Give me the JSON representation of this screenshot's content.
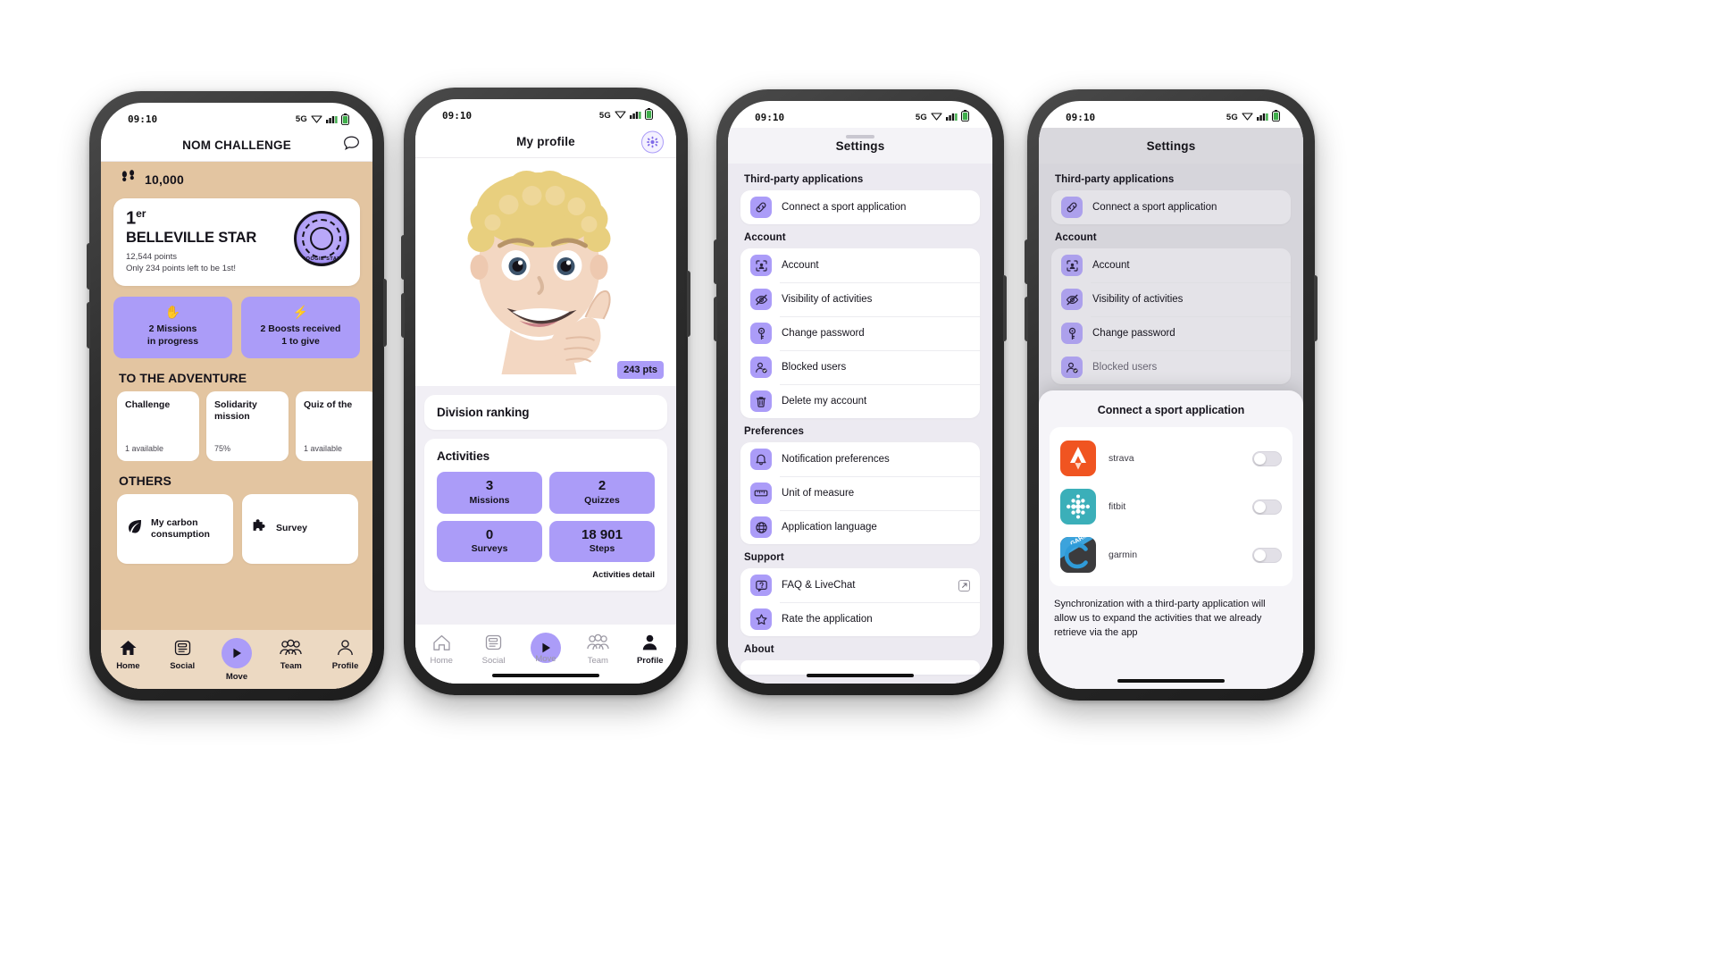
{
  "status_bar": {
    "time": "09:10",
    "network": "5G"
  },
  "phone1": {
    "nav_title": "NOM CHALLENGE",
    "chat_icon": "chat-bubble-icon",
    "steps": {
      "icon": "footsteps-icon",
      "value": "10,000"
    },
    "rank_card": {
      "position": "1",
      "position_suffix": "er",
      "team": "BELLEVILLE STAR",
      "points": "12,544 points",
      "gap": "Only 234 points left to be 1st!",
      "badge_text": "BOOGIE STAR"
    },
    "pills": [
      {
        "icon": "wave-hand-icon",
        "line1": "2 Missions",
        "line2": "in progress"
      },
      {
        "icon": "bolt-icon",
        "line1": "2 Boosts received",
        "line2": "1 to give"
      }
    ],
    "adventure_heading": "TO THE ADVENTURE",
    "adventure_tiles": [
      {
        "title": "Challenge",
        "sub": "1 available"
      },
      {
        "title": "Solidarity mission",
        "sub": "75%"
      },
      {
        "title": "Quiz of the",
        "sub": "1 available"
      }
    ],
    "others_heading": "OTHERS",
    "others": [
      {
        "icon": "leaf-icon",
        "label": "My carbon consumption"
      },
      {
        "icon": "puzzle-icon",
        "label": "Survey"
      }
    ],
    "tabs": [
      {
        "label": "Home",
        "icon": "home-icon",
        "active": true
      },
      {
        "label": "Social",
        "icon": "feed-icon",
        "active": false
      },
      {
        "label": "Move",
        "icon": "play-icon",
        "active": false
      },
      {
        "label": "Team",
        "icon": "people-icon",
        "active": false
      },
      {
        "label": "Profile",
        "icon": "person-icon",
        "active": false
      }
    ]
  },
  "phone2": {
    "nav_title": "My profile",
    "settings_icon": "gear-icon",
    "points_badge": "243 pts",
    "division_card": "Division ranking",
    "activities_title": "Activities",
    "activities": [
      {
        "value": "3",
        "label": "Missions"
      },
      {
        "value": "2",
        "label": "Quizzes"
      },
      {
        "value": "0",
        "label": "Surveys"
      },
      {
        "value": "18 901",
        "label": "Steps"
      }
    ],
    "activities_detail_link": "Activities detail",
    "tabs": [
      {
        "label": "Home",
        "icon": "home-icon",
        "active": false
      },
      {
        "label": "Social",
        "icon": "feed-icon",
        "active": false
      },
      {
        "label": "Move",
        "icon": "play-icon",
        "active": false
      },
      {
        "label": "Team",
        "icon": "people-icon",
        "active": false
      },
      {
        "label": "Profile",
        "icon": "person-icon",
        "active": true
      }
    ]
  },
  "phone3": {
    "nav_title": "Settings",
    "sections": [
      {
        "heading": "Third-party applications",
        "rows": [
          {
            "label": "Connect a sport application",
            "icon": "link-icon"
          }
        ]
      },
      {
        "heading": "Account",
        "rows": [
          {
            "label": "Account",
            "icon": "account-id-icon"
          },
          {
            "label": "Visibility of activities",
            "icon": "eye-off-icon"
          },
          {
            "label": "Change password",
            "icon": "key-icon"
          },
          {
            "label": "Blocked users",
            "icon": "blocked-user-icon"
          },
          {
            "label": "Delete my account",
            "icon": "trash-icon"
          }
        ]
      },
      {
        "heading": "Preferences",
        "rows": [
          {
            "label": "Notification preferences",
            "icon": "bell-icon"
          },
          {
            "label": "Unit of measure",
            "icon": "ruler-icon"
          },
          {
            "label": "Application language",
            "icon": "globe-icon"
          }
        ]
      },
      {
        "heading": "Support",
        "rows": [
          {
            "label": "FAQ & LiveChat",
            "icon": "faq-icon",
            "external": true
          },
          {
            "label": "Rate the application",
            "icon": "star-icon"
          }
        ]
      },
      {
        "heading": "About",
        "rows": []
      }
    ]
  },
  "phone4": {
    "nav_title": "Settings",
    "sections": [
      {
        "heading": "Third-party applications",
        "rows": [
          {
            "label": "Connect a sport application",
            "icon": "link-icon"
          }
        ]
      },
      {
        "heading": "Account",
        "rows": [
          {
            "label": "Account",
            "icon": "account-id-icon"
          },
          {
            "label": "Visibility of activities",
            "icon": "eye-off-icon"
          },
          {
            "label": "Change password",
            "icon": "key-icon"
          },
          {
            "label": "Blocked users",
            "icon": "blocked-user-icon"
          }
        ]
      }
    ],
    "sheet": {
      "title": "Connect a sport application",
      "apps": [
        {
          "name": "strava",
          "icon": "strava-logo",
          "color": "#F05421",
          "enabled": false
        },
        {
          "name": "fitbit",
          "icon": "fitbit-logo",
          "color": "#3BAFB9",
          "enabled": false
        },
        {
          "name": "garmin",
          "icon": "garmin-logo",
          "color": "#3B3B3D",
          "enabled": false
        }
      ],
      "note": "Synchronization with a third-party application will allow us to expand the activities that we already retrieve via the app"
    }
  },
  "theme": {
    "accent_purple": "#AB9CF8",
    "beige_bg": "#E3C5A1",
    "tabbar_beige": "#ECD9C2",
    "settings_bg": "#ECEAF1",
    "arrow_green": "#A9E0A5"
  }
}
